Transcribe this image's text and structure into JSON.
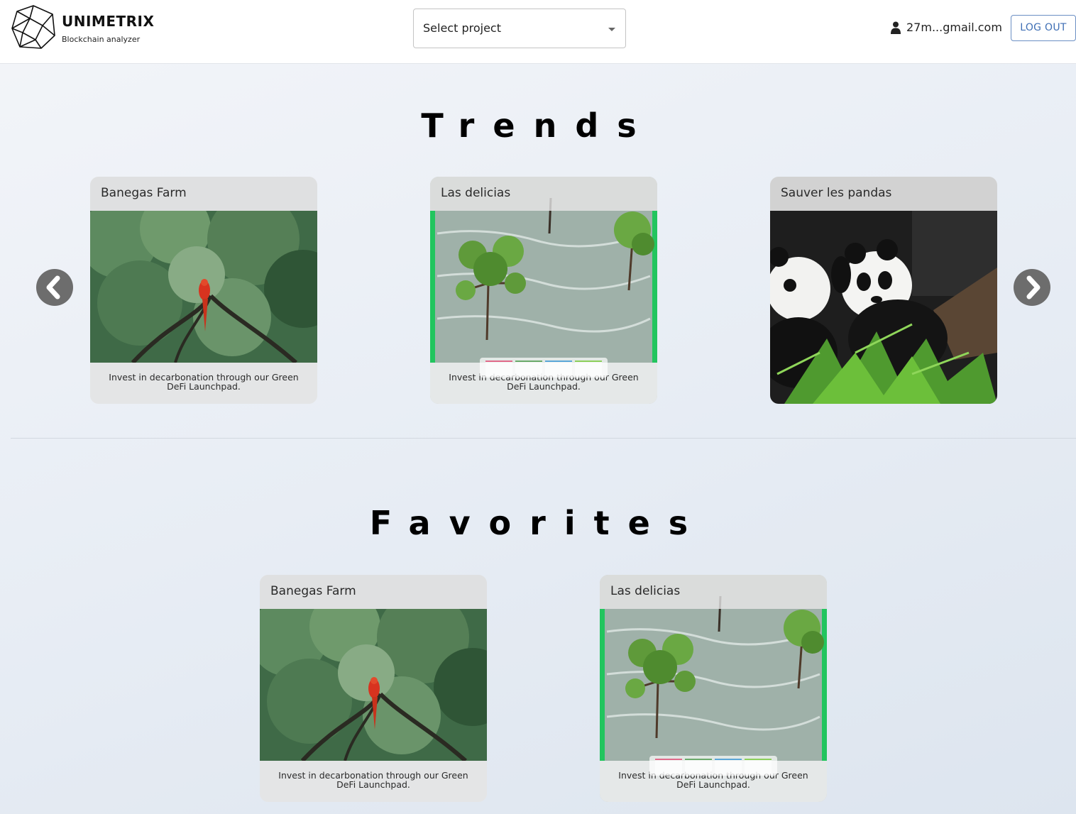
{
  "header": {
    "brand": "UNIMETRIX",
    "tagline": "Blockchain analyzer",
    "project_select": "Select project",
    "user_email": "27m...gmail.com",
    "logout_label": "LOG OUT"
  },
  "trends": {
    "title": "Trends",
    "cards": [
      {
        "title": "Banegas Farm",
        "description": "Invest in decarbonation through our Green DeFi Launchpad.",
        "image": "parrot-in-tree"
      },
      {
        "title": "Las delicias",
        "description": "Invest in decarbonation through our Green DeFi Launchpad.",
        "image": "mangrove-in-water"
      },
      {
        "title": "Sauver les pandas",
        "description": "",
        "image": "pandas-eating-bamboo"
      }
    ]
  },
  "favorites": {
    "title": "Favorites",
    "cards": [
      {
        "title": "Banegas Farm",
        "description": "Invest in decarbonation through our Green DeFi Launchpad.",
        "image": "parrot-in-tree"
      },
      {
        "title": "Las delicias",
        "description": "Invest in decarbonation through our Green DeFi Launchpad.",
        "image": "mangrove-in-water"
      }
    ]
  },
  "icons": {
    "prev": "chevron-left-icon",
    "next": "chevron-right-icon",
    "user": "user-icon",
    "logo": "polyhedron-logo"
  },
  "colors": {
    "accent": "#3f6fb5",
    "arrow": "#6d6d6d",
    "mangrove_border": "#22c55e"
  }
}
